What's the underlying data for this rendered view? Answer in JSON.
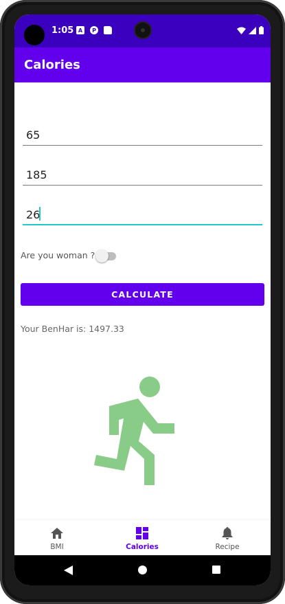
{
  "status_bar": {
    "time": "1:05",
    "notification_icons": [
      "a-icon",
      "p-icon",
      "sd-card-icon"
    ],
    "system_icons": [
      "wifi-icon",
      "signal-icon",
      "battery-icon"
    ]
  },
  "app_bar": {
    "title": "Calories"
  },
  "form": {
    "weight_value": "65",
    "height_value": "185",
    "age_value": "26",
    "woman_label": "Are you woman ?",
    "woman_toggle_on": false
  },
  "calculate_button": "CALCULATE",
  "result_text": "Your BenHar is: 1497.33",
  "illustration": {
    "icon": "running-person-icon",
    "color": "#88cc88"
  },
  "bottom_nav": {
    "items": [
      {
        "label": "BMI",
        "icon": "home-icon",
        "active": false
      },
      {
        "label": "Calories",
        "icon": "dashboard-icon",
        "active": true
      },
      {
        "label": "Recipe",
        "icon": "bell-icon",
        "active": false
      }
    ]
  },
  "colors": {
    "status_bar": "#3a00bd",
    "primary": "#6200ee",
    "focus_accent": "#1fc9c9",
    "runner": "#88cc88"
  }
}
